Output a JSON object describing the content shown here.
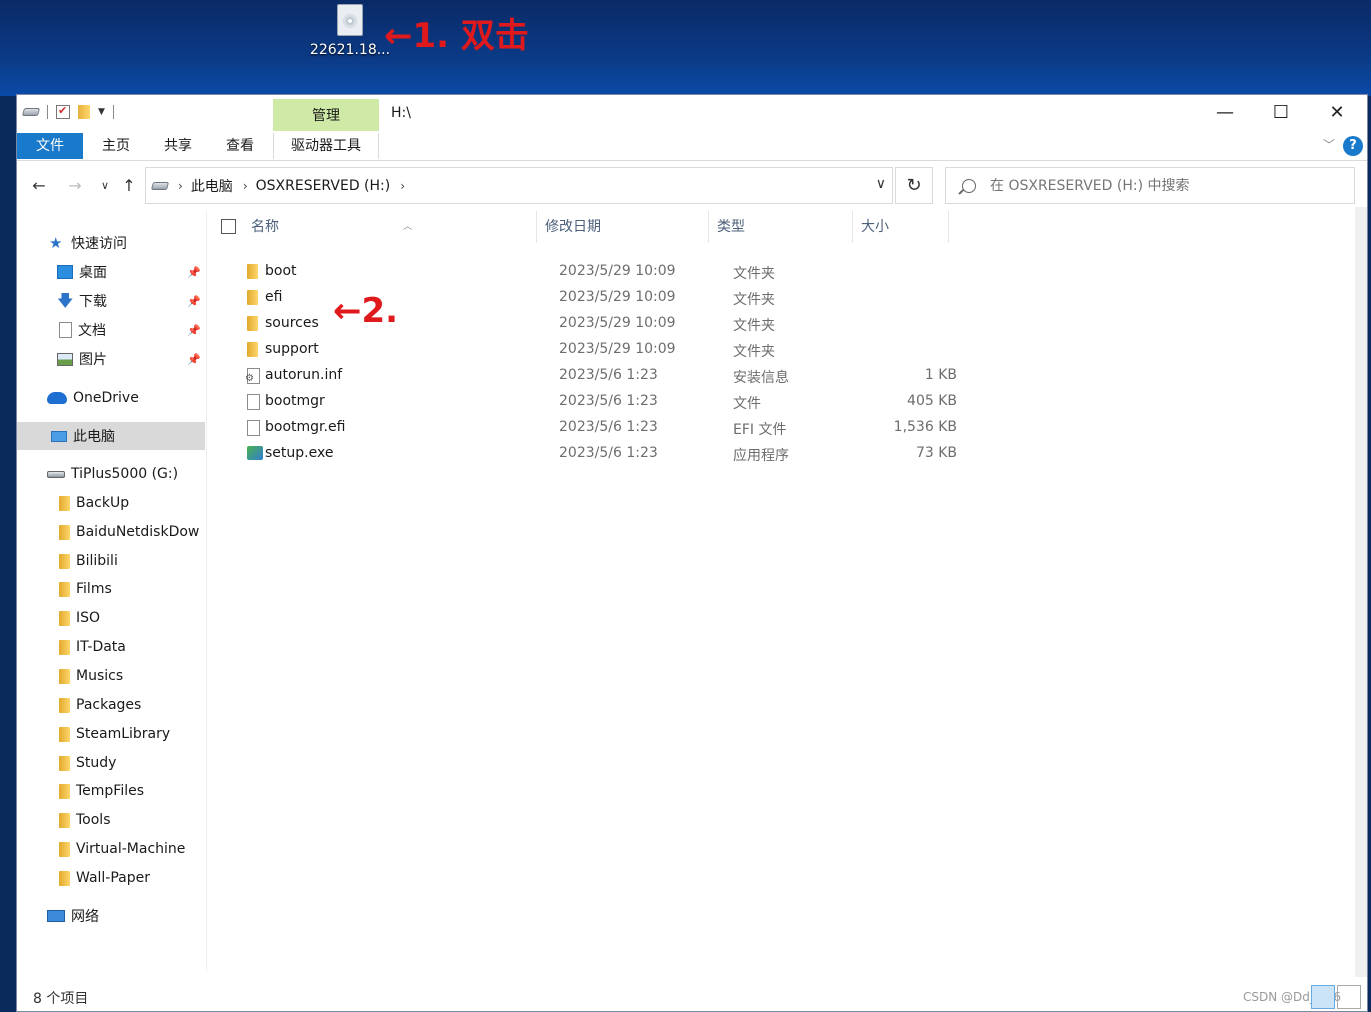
{
  "desktop": {
    "icon_label": "22621.18...",
    "annotation_1": "←1. 双击",
    "annotation_2": "←2."
  },
  "window": {
    "title_path": "H:\\",
    "contextual_tab": "管理",
    "ribbon_tabs": [
      "文件",
      "主页",
      "共享",
      "查看",
      "驱动器工具"
    ],
    "controls": {
      "minimize": "—",
      "maximize": "☐",
      "close": "✕",
      "help": "?"
    }
  },
  "address": {
    "crumbs": [
      "此电脑",
      "OSXRESERVED (H:)"
    ],
    "search_placeholder": "在 OSXRESERVED (H:) 中搜索"
  },
  "navpane": {
    "quick_access": "快速访问",
    "pinned": [
      "桌面",
      "下载",
      "文档",
      "图片"
    ],
    "onedrive": "OneDrive",
    "this_pc": "此电脑",
    "drive": "TiPlus5000 (G:)",
    "folders": [
      "BackUp",
      "BaiduNetdiskDow",
      "Bilibili",
      "Films",
      "ISO",
      "IT-Data",
      "Musics",
      "Packages",
      "SteamLibrary",
      "Study",
      "TempFiles",
      "Tools",
      "Virtual-Machine",
      "Wall-Paper"
    ],
    "network": "网络"
  },
  "columns": {
    "name": "名称",
    "date": "修改日期",
    "type": "类型",
    "size": "大小"
  },
  "files": [
    {
      "name": "boot",
      "date": "2023/5/29 10:09",
      "type": "文件夹",
      "size": "",
      "icon": "folder"
    },
    {
      "name": "efi",
      "date": "2023/5/29 10:09",
      "type": "文件夹",
      "size": "",
      "icon": "folder"
    },
    {
      "name": "sources",
      "date": "2023/5/29 10:09",
      "type": "文件夹",
      "size": "",
      "icon": "folder"
    },
    {
      "name": "support",
      "date": "2023/5/29 10:09",
      "type": "文件夹",
      "size": "",
      "icon": "folder"
    },
    {
      "name": "autorun.inf",
      "date": "2023/5/6 1:23",
      "type": "安装信息",
      "size": "1 KB",
      "icon": "inf"
    },
    {
      "name": "bootmgr",
      "date": "2023/5/6 1:23",
      "type": "文件",
      "size": "405 KB",
      "icon": "file"
    },
    {
      "name": "bootmgr.efi",
      "date": "2023/5/6 1:23",
      "type": "EFI 文件",
      "size": "1,536 KB",
      "icon": "file"
    },
    {
      "name": "setup.exe",
      "date": "2023/5/6 1:23",
      "type": "应用程序",
      "size": "73 KB",
      "icon": "exe"
    }
  ],
  "status": {
    "count": "8 个项目",
    "watermark": "CSDN @Dd_w66"
  },
  "colors": {
    "accent": "#1979ca",
    "manage_tab": "#cfeaa6",
    "annotation": "#e0191c"
  }
}
